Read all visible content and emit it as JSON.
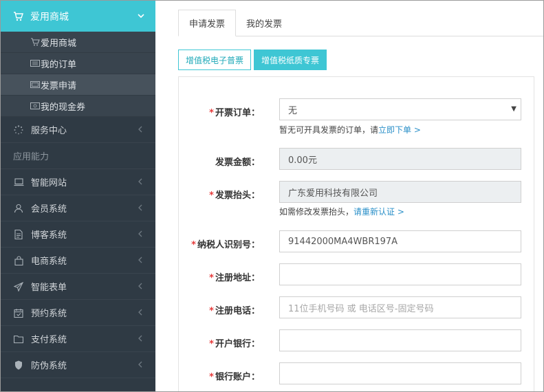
{
  "sidebar": {
    "top": {
      "label": "爱用商城"
    },
    "subitems": [
      {
        "label": "爱用商城",
        "icon": "cart-icon"
      },
      {
        "label": "我的订单",
        "icon": "list-icon"
      },
      {
        "label": "发票申请",
        "icon": "invoice-icon",
        "active": true
      },
      {
        "label": "我的现金券",
        "icon": "coupon-icon"
      }
    ],
    "service": {
      "label": "服务中心"
    },
    "section_title": "应用能力",
    "items": [
      {
        "label": "智能网站",
        "icon": "laptop-icon"
      },
      {
        "label": "会员系统",
        "icon": "user-icon"
      },
      {
        "label": "博客系统",
        "icon": "document-icon"
      },
      {
        "label": "电商系统",
        "icon": "bag-icon"
      },
      {
        "label": "智能表单",
        "icon": "paper-plane-icon"
      },
      {
        "label": "预约系统",
        "icon": "calendar-icon"
      },
      {
        "label": "支付系统",
        "icon": "folder-icon"
      },
      {
        "label": "防伪系统",
        "icon": "shield-icon"
      }
    ]
  },
  "main": {
    "tabs": [
      {
        "label": "申请发票",
        "active": true
      },
      {
        "label": "我的发票",
        "active": false
      }
    ],
    "invoice_types": {
      "electronic": "增值税电子普票",
      "paper": "增值税纸质专票"
    },
    "form": {
      "order": {
        "label": "开票订单：",
        "value": "无",
        "hint_prefix": "暂无可开具发票的订单，请",
        "hint_link": "立即下单 >"
      },
      "amount": {
        "label": "发票金额：",
        "value": "0.00元"
      },
      "title": {
        "label": "发票抬头：",
        "value": "广东爱用科技有限公司",
        "hint_prefix": "如需修改发票抬头，",
        "hint_link": "请重新认证 >"
      },
      "tax_id": {
        "label": "纳税人识别号：",
        "value": "91442000MA4WBR197A"
      },
      "address": {
        "label": "注册地址：",
        "value": ""
      },
      "phone": {
        "label": "注册电话：",
        "placeholder": "11位手机号码 或 电话区号-固定号码"
      },
      "bank": {
        "label": "开户银行：",
        "value": ""
      },
      "account": {
        "label": "银行账户：",
        "value": ""
      }
    },
    "required_mark": "*"
  },
  "colors": {
    "accent": "#3ec6d4",
    "sidebar_bg": "#2f3a44",
    "required": "#e63b3b",
    "link": "#2a8fc8"
  }
}
